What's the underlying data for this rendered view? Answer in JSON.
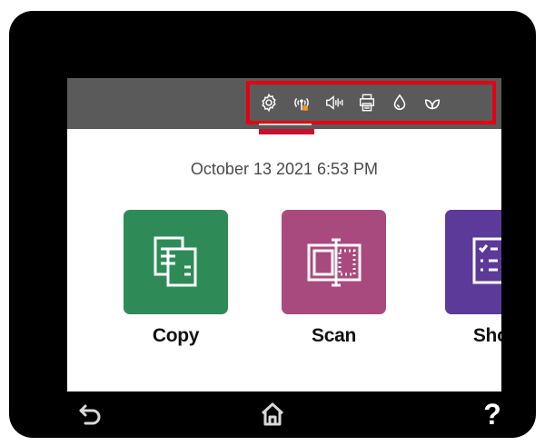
{
  "status_bar": {
    "icons": [
      "settings-icon",
      "wireless-icon",
      "volume-icon",
      "print-icon",
      "ink-icon",
      "eco-icon"
    ],
    "highlight_color": "#e60012",
    "background": "#5a5a5a"
  },
  "datetime": "October 13 2021  6:53 PM",
  "apps": [
    {
      "label": "Copy",
      "icon": "copy-icon",
      "color": "#2e8b57"
    },
    {
      "label": "Scan",
      "icon": "scan-icon",
      "color": "#a94a7e"
    },
    {
      "label": "Short",
      "icon": "shortcuts-icon",
      "color": "#5b3a9a"
    }
  ],
  "nav": {
    "back_icon": "back-icon",
    "home_icon": "home-icon",
    "help_label": "?"
  }
}
